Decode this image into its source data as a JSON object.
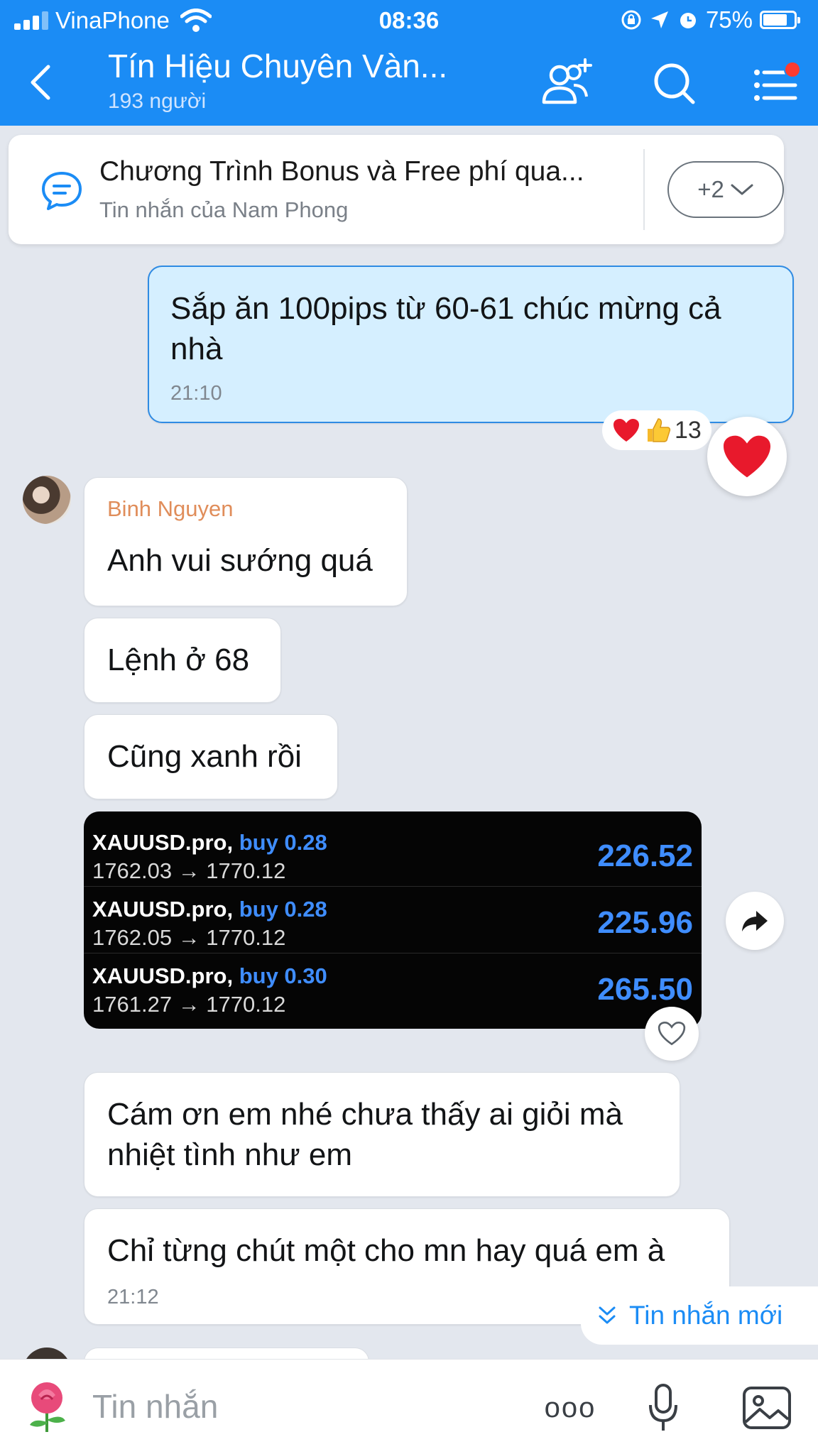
{
  "status_bar": {
    "carrier": "VinaPhone",
    "time": "08:36",
    "battery": "75%",
    "battery_level": 0.75
  },
  "header": {
    "title": "Tín Hiệu Chuyên Vàn...",
    "subtitle": "193 người"
  },
  "pinned": {
    "title": "Chương Trình Bonus và Free phí qua...",
    "subtitle": "Tin nhắn của Nam Phong",
    "more_label": "+2"
  },
  "messages": {
    "own": {
      "text": "Sắp ăn 100pips từ 60-61 chúc mừng cả nhà",
      "time": "21:10",
      "reaction_count": "13"
    },
    "sender_name": "Binh Nguyen",
    "m1": "Anh vui sướng quá",
    "m2": "Lệnh ở 68",
    "m3": "Cũng xanh rồi",
    "trades": [
      {
        "symbol": "XAUUSD.pro,",
        "side": "buy 0.28",
        "prices": "1762.03 → 1770.12",
        "profit": "226.52"
      },
      {
        "symbol": "XAUUSD.pro,",
        "side": "buy 0.28",
        "prices": "1762.05 → 1770.12",
        "profit": "225.96"
      },
      {
        "symbol": "XAUUSD.pro,",
        "side": "buy 0.30",
        "prices": "1761.27 → 1770.12",
        "profit": "265.50"
      }
    ],
    "m4": "Cám ơn em nhé chưa thấy ai giỏi mà nhiệt tình như em",
    "m5": "Chỉ từng chút một cho mn hay quá em à",
    "m5_time": "21:12"
  },
  "new_messages_label": "Tin nhắn mới",
  "input": {
    "placeholder": "Tin nhắn",
    "more_label": "ooo"
  },
  "colors": {
    "header_bg": "#1b8cf5",
    "own_bubble": "#d5efff",
    "sender_name": "#e08d5a",
    "profit_blue": "#3f8dff"
  }
}
